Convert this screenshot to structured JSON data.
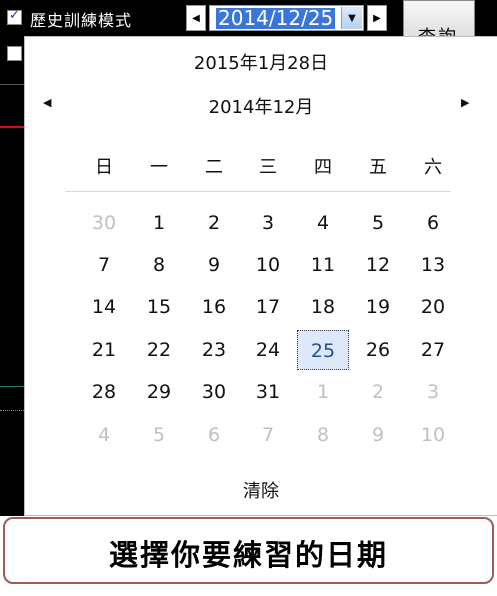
{
  "toolbar": {
    "history_mode_label": "歷史訓練模式",
    "history_mode_checked": true,
    "date_value": "2014/12/25",
    "query_button": "查詢"
  },
  "calendar": {
    "today_line": "2015年1月28日",
    "month_title": "2014年12月",
    "clear_label": "清除",
    "weekdays": [
      "日",
      "一",
      "二",
      "三",
      "四",
      "五",
      "六"
    ],
    "weeks": [
      [
        "30",
        "1",
        "2",
        "3",
        "4",
        "5",
        "6"
      ],
      [
        "7",
        "8",
        "9",
        "10",
        "11",
        "12",
        "13"
      ],
      [
        "14",
        "15",
        "16",
        "17",
        "18",
        "19",
        "20"
      ],
      [
        "21",
        "22",
        "23",
        "24",
        "25",
        "26",
        "27"
      ],
      [
        "28",
        "29",
        "30",
        "31",
        "1",
        "2",
        "3"
      ],
      [
        "4",
        "5",
        "6",
        "7",
        "8",
        "9",
        "10"
      ]
    ],
    "selected_day": "25"
  },
  "caption": "選擇你要練習的日期",
  "colors": {
    "selection_highlight": "#3a76d8",
    "selected_day_bg": "#dde9f8",
    "muted_day": "#c0c0c0",
    "caption_border": "#a05a5a"
  }
}
